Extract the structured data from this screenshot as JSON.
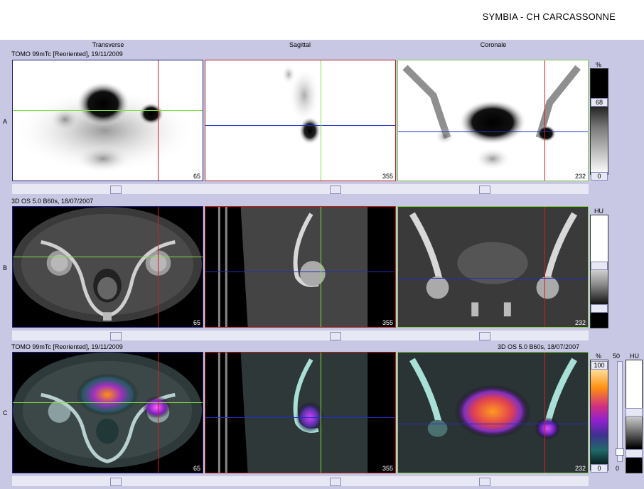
{
  "header": {
    "site": "SYMBIA - CH CARCASSONNE"
  },
  "columns": {
    "transverse": "Transverse",
    "sagittal": "Sagittal",
    "coronal": "Coronale"
  },
  "rows": {
    "a": {
      "letter": "A",
      "caption": "TOMO 99mTc [Reoriented], 19/11/2009"
    },
    "b": {
      "letter": "B",
      "caption": "3D  OS  5.0  B60s, 18/07/2007"
    },
    "c": {
      "letter": "C",
      "caption_left": "TOMO 99mTc [Reoriented], 19/11/2009",
      "caption_right": "3D  OS  5.0  B60s, 18/07/2007"
    }
  },
  "slices": {
    "transverse": "65",
    "sagittal": "355",
    "coronal": "232"
  },
  "colorbars": {
    "a": {
      "unit": "%",
      "max": "68",
      "min": "0"
    },
    "b": {
      "unit": "HU"
    },
    "c": {
      "unit_pet": "%",
      "max": "100",
      "min": "0",
      "fusion": "50",
      "unit_ct": "HU",
      "fusion_min": "0"
    }
  },
  "colors": {
    "background": "#c8c8e4",
    "crosshair_green": "#80e040",
    "crosshair_red": "#d02020",
    "crosshair_blue": "#2030c0"
  }
}
